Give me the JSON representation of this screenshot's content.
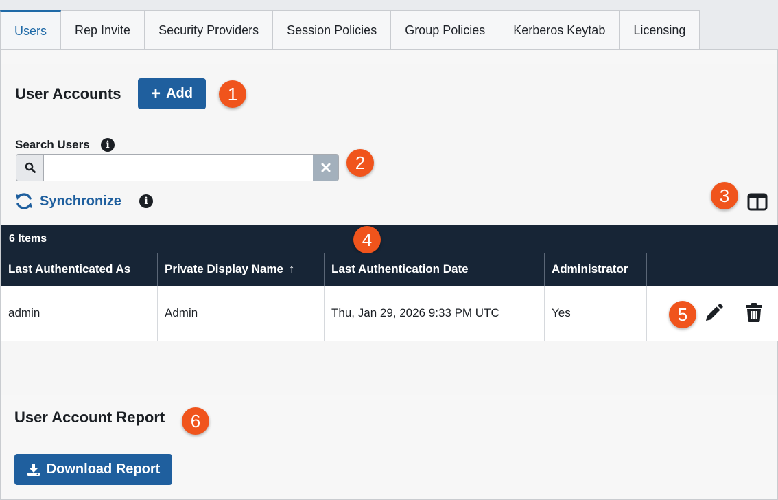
{
  "tabs": [
    {
      "label": "Users",
      "active": true
    },
    {
      "label": "Rep Invite"
    },
    {
      "label": "Security Providers"
    },
    {
      "label": "Session Policies"
    },
    {
      "label": "Group Policies"
    },
    {
      "label": "Kerberos Keytab"
    },
    {
      "label": "Licensing"
    }
  ],
  "accounts": {
    "title": "User Accounts",
    "add_label": "Add"
  },
  "search": {
    "label": "Search Users",
    "value": "",
    "placeholder": "",
    "info_icon": "i"
  },
  "sync": {
    "label": "Synchronize",
    "info_icon": "i"
  },
  "table": {
    "count_label": "6 Items",
    "columns": [
      {
        "label": "Last Authenticated As"
      },
      {
        "label": "Private Display Name",
        "sort_indicator": "↑"
      },
      {
        "label": "Last Authentication Date"
      },
      {
        "label": "Administrator"
      },
      {
        "label": ""
      }
    ],
    "rows": [
      {
        "last_authenticated_as": "admin",
        "private_display_name": "Admin",
        "last_authentication_date": "Thu, Jan 29, 2026 9:33 PM UTC",
        "administrator": "Yes"
      }
    ]
  },
  "report": {
    "title": "User Account Report",
    "download_label": "Download Report"
  },
  "callouts": [
    "1",
    "2",
    "3",
    "4",
    "5",
    "6"
  ],
  "colors": {
    "primary": "#1f5f9e",
    "header_dark": "#172536",
    "callout": "#f0541c"
  }
}
